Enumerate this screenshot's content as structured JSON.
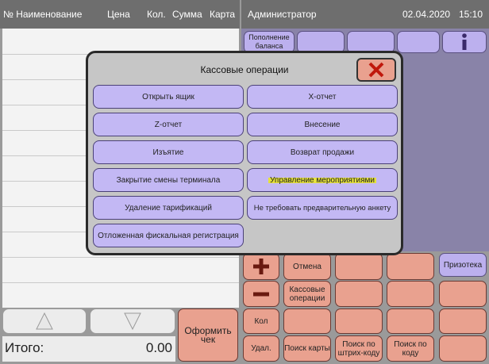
{
  "receipt_header": {
    "name_col": "№ Наименование",
    "price_col": "Цена",
    "qty_col": "Кол.",
    "sum_col": "Сумма",
    "card_col": "Карта"
  },
  "status_bar": {
    "user": "Администратор",
    "date": "02.04.2020",
    "time": "15:10"
  },
  "total": {
    "label": "Итого:",
    "value": "0.00"
  },
  "checkout_button": "Оформить чек",
  "top_buttons": {
    "topup_balance": "Пополнение баланса"
  },
  "right_grid": {
    "cancel": "Отмена",
    "cash_operations": "Кассовые операции",
    "qty": "Кол",
    "delete": "Удал.",
    "card_search": "Поиск карты",
    "barcode_search": "Поиск по штрих-коду",
    "code_search": "Поиск по коду",
    "prizoteka": "Призотека"
  },
  "modal": {
    "title": "Кассовые операции",
    "buttons": [
      "Открыть ящик",
      "Х-отчет",
      "Z-отчет",
      "Внесение",
      "Изъятие",
      "Возврат продажи",
      "Закрытие смены терминала",
      "Управление мероприятиями",
      "Удаление тарификаций",
      "Не требовать предварительную анкету",
      "Отложенная фискальная регистрация"
    ]
  },
  "colors": {
    "modal_button": "#c3b8f4",
    "highlight": "#e6e23c",
    "close_button": "#e9a18f"
  }
}
